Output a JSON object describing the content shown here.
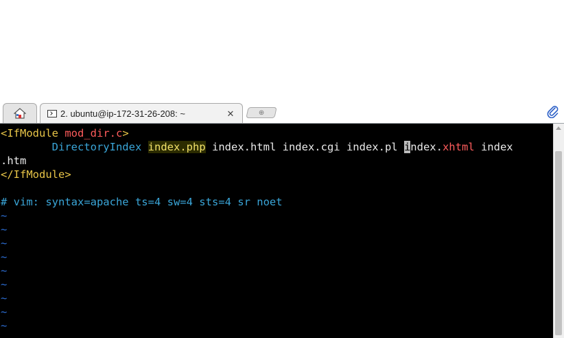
{
  "tabs": {
    "active_title": "2. ubuntu@ip-172-31-26-208: ~",
    "close_glyph": "✕",
    "new_tab_glyph": "⊕",
    "icons": [
      "home-icon",
      "terminal-icon",
      "close-icon",
      "new-tab-icon",
      "paperclip-icon"
    ]
  },
  "editor": {
    "line1": {
      "open": "<IfModule ",
      "module": "mod_dir.c",
      "close": ">"
    },
    "line2": {
      "indent": "        ",
      "directive": "DirectoryIndex",
      "space": " ",
      "php": "index.php",
      "middle": " index.html index.cgi index.pl ",
      "cursor_char": "i",
      "after_cursor": "ndex.",
      "xhtml": "xhtml",
      "tail": " index"
    },
    "line3": ".htm",
    "line4": "</IfModule>",
    "line6": "# vim: syntax=apache ts=4 sw=4 sts=4 sr noet",
    "tilde": "~",
    "tilde_count": 9
  },
  "colors": {
    "background": "#000000",
    "tag": "#e8c548",
    "keyword": "#3aa6d9",
    "error_red": "#ff5c5c",
    "tilde": "#2d6fd6"
  }
}
